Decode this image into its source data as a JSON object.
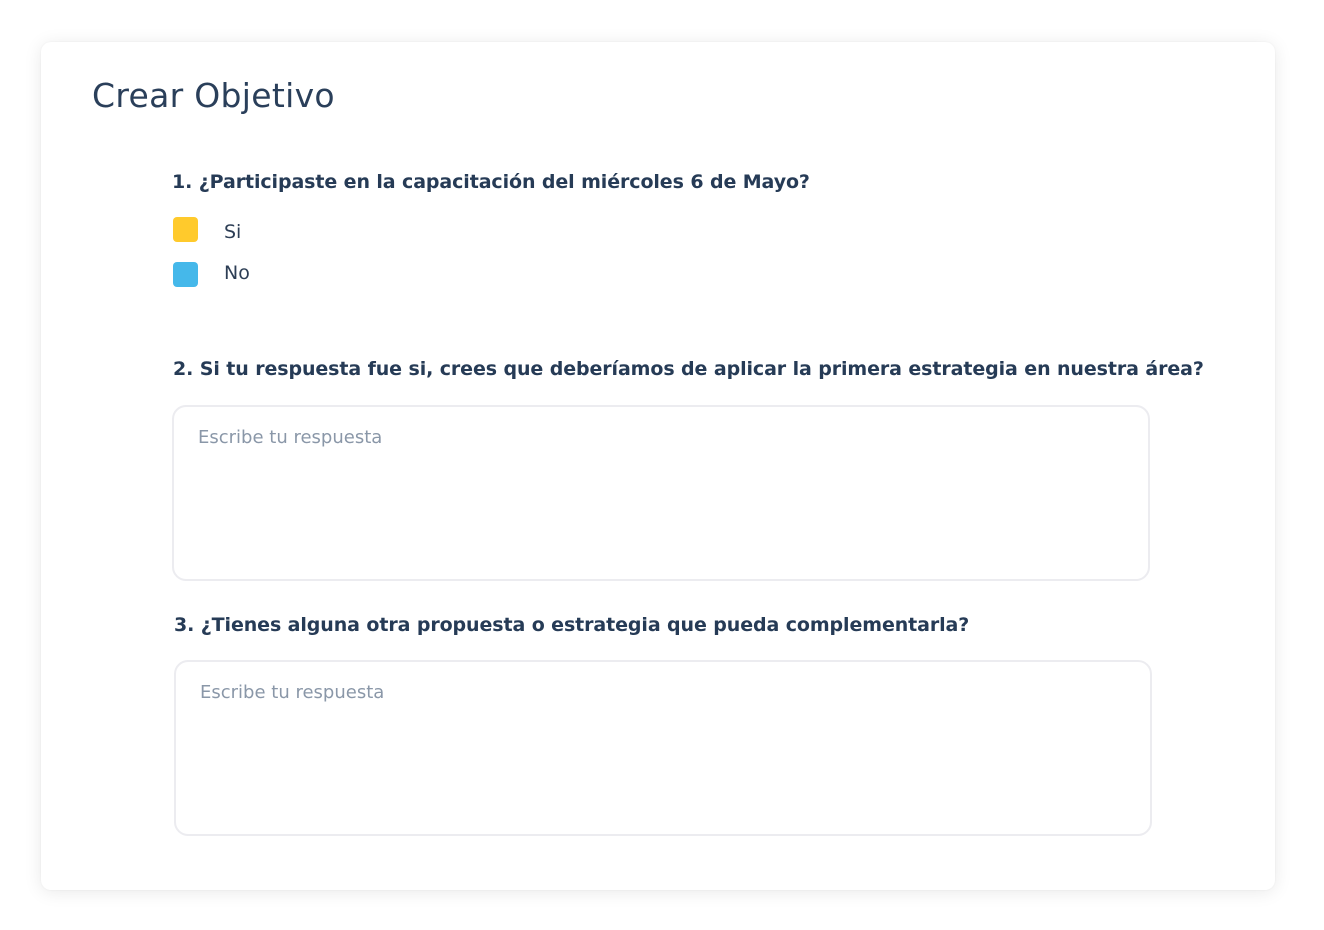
{
  "page": {
    "title": "Crear Objetivo"
  },
  "questions": [
    {
      "text": "1. ¿Participaste en la capacitación del miércoles 6 de Mayo?",
      "options": [
        {
          "label": "Si",
          "color": "#FFCA2C"
        },
        {
          "label": "No",
          "color": "#45B8EA"
        }
      ]
    },
    {
      "text": "2. Si tu respuesta fue si, crees que deberíamos de aplicar la primera estrategia en nuestra área?",
      "placeholder": "Escribe tu respuesta"
    },
    {
      "text": "3. ¿Tienes alguna otra propuesta o estrategia que pueda complementarla?",
      "placeholder": "Escribe tu respuesta"
    }
  ],
  "colors": {
    "text": "#263B56",
    "placeholder": "#8A97A8",
    "border": "#ECECF0",
    "option_yes": "#FFCA2C",
    "option_no": "#45B8EA"
  }
}
